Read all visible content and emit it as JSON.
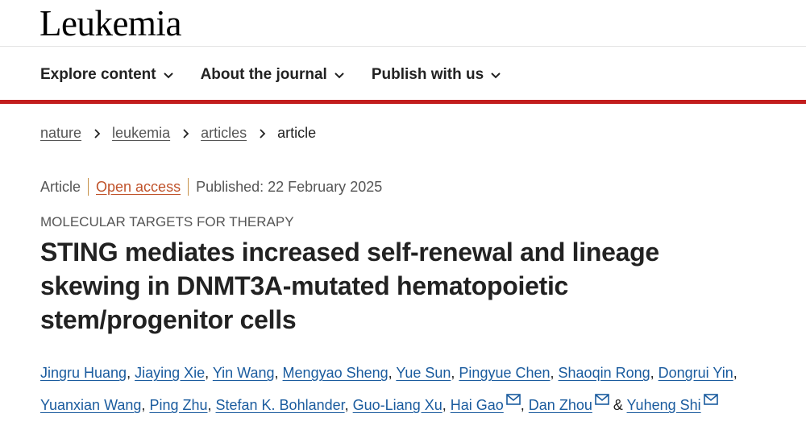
{
  "header": {
    "logo": "Leukemia"
  },
  "nav": {
    "items": [
      {
        "label": "Explore content"
      },
      {
        "label": "About the journal"
      },
      {
        "label": "Publish with us"
      }
    ]
  },
  "breadcrumb": {
    "items": [
      "nature",
      "leukemia",
      "articles"
    ],
    "current": "article"
  },
  "meta": {
    "type": "Article",
    "access": "Open access",
    "published": "Published: 22 February 2025"
  },
  "subject": "MOLECULAR TARGETS FOR THERAPY",
  "title": "STING mediates increased self-renewal and lineage skewing in DNMT3A-mutated hematopoietic stem/progenitor cells",
  "authors": [
    {
      "name": "Jingru Huang"
    },
    {
      "name": "Jiaying Xie"
    },
    {
      "name": "Yin Wang"
    },
    {
      "name": "Mengyao Sheng"
    },
    {
      "name": "Yue Sun"
    },
    {
      "name": "Pingyue Chen"
    },
    {
      "name": "Shaoqin Rong"
    },
    {
      "name": "Dongrui Yin"
    },
    {
      "name": "Yuanxian Wang"
    },
    {
      "name": "Ping Zhu"
    },
    {
      "name": "Stefan K. Bohlander"
    },
    {
      "name": "Guo-Liang Xu"
    },
    {
      "name": "Hai Gao",
      "icon": "mail-icon"
    },
    {
      "name": "Dan Zhou",
      "icon": "mail-icon"
    },
    {
      "name": "Yuheng Shi",
      "icon": "mail-icon"
    }
  ],
  "authors_separator": ", ",
  "authors_last_separator": " & ",
  "colors": {
    "brand_red": "#c21d1d",
    "link_blue": "#1a5b9e",
    "open_access_orange": "#c0532b"
  }
}
